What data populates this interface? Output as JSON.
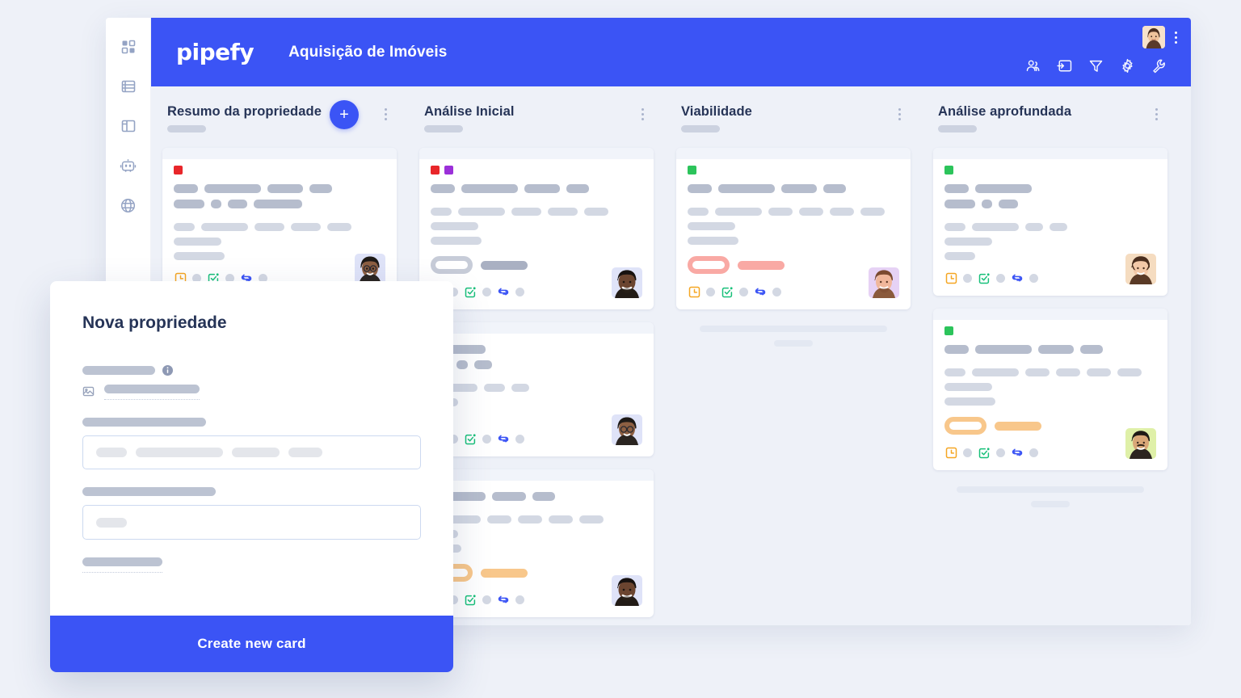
{
  "app": {
    "logo_text": "pipefy",
    "board_title": "Aquisição de Imóveis",
    "accent_color": "#3b54f5",
    "board_bg": "#eef1f8"
  },
  "sidebar": {
    "items": [
      {
        "icon": "grid-dashboard-icon",
        "label": ""
      },
      {
        "icon": "database-icon",
        "label": ""
      },
      {
        "icon": "layout-panel-icon",
        "label": ""
      },
      {
        "icon": "robot-automation-icon",
        "label": ""
      },
      {
        "icon": "globe-icon",
        "label": ""
      }
    ]
  },
  "topbar": {
    "avatar_alt": "user-avatar",
    "kebab": "⋮",
    "icons": [
      {
        "name": "members-icon"
      },
      {
        "name": "import-card-icon"
      },
      {
        "name": "filter-icon"
      },
      {
        "name": "settings-gear-icon"
      },
      {
        "name": "tools-wrench-icon"
      }
    ]
  },
  "board": {
    "add_card_label": "+",
    "columns": [
      {
        "title": "Resumo da propriedade",
        "has_add_button": true,
        "cards": [
          {
            "chips": [
              "#e8262a"
            ],
            "title_widths": [
              [
                30,
                70,
                44,
                28
              ],
              [
                38,
                13,
                24,
                60
              ]
            ],
            "body_widths": [
              [
                26,
                58,
                37,
                37,
                30
              ],
              [
                59
              ],
              [
                63
              ]
            ],
            "badge": null,
            "avatar_bg": "#dfe3f8",
            "avatar_tone": "#6b4a36"
          }
        ],
        "ghost": false
      },
      {
        "title": "Análise Inicial",
        "has_add_button": false,
        "cards": [
          {
            "chips": [
              "#e8262a",
              "#9b30d9"
            ],
            "title_widths": [
              [
                30,
                70,
                44,
                28
              ]
            ],
            "body_widths": [
              [
                26,
                58,
                37,
                37,
                30
              ],
              [
                59
              ],
              [
                63
              ]
            ],
            "badge": "outline-gray",
            "avatar_bg": "#dfe3f8",
            "avatar_tone": "#4e3328"
          },
          {
            "chips": [],
            "title_widths": [
              [
                68
              ],
              [
                24,
                14,
                22
              ]
            ],
            "body_widths": [
              [
                58,
                26,
                22
              ],
              [
                34
              ],
              [
                10
              ]
            ],
            "badge": null,
            "avatar_bg": "#dfe3f8",
            "avatar_tone": "#6b4a36"
          },
          {
            "chips": [],
            "title_widths": [
              [
                68,
                42,
                28
              ]
            ],
            "body_widths": [
              [
                62,
                30,
                30,
                30,
                30
              ],
              [
                34
              ],
              [
                38
              ]
            ],
            "badge": "orange",
            "avatar_bg": "#dfe3f8",
            "avatar_tone": "#4e3328"
          }
        ],
        "ghost": false
      },
      {
        "title": "Viabilidade",
        "has_add_button": false,
        "cards": [
          {
            "chips": [
              "#2cc45b"
            ],
            "title_widths": [
              [
                30,
                70,
                44,
                28
              ]
            ],
            "body_widths": [
              [
                26,
                58,
                30,
                30,
                30,
                30
              ],
              [
                59
              ],
              [
                63
              ]
            ],
            "badge": "red",
            "avatar_bg": "#e6d2f5",
            "avatar_tone": "#e0a98b"
          }
        ],
        "ghost": true
      },
      {
        "title": "Análise aprofundada",
        "has_add_button": false,
        "cards": [
          {
            "chips": [
              "#2cc45b"
            ],
            "title_widths": [
              [
                30,
                70
              ],
              [
                38,
                13,
                24
              ]
            ],
            "body_widths": [
              [
                26,
                58,
                22,
                22
              ],
              [
                59
              ],
              [
                38
              ]
            ],
            "badge": null,
            "avatar_bg": "#f5dcc0",
            "avatar_tone": "#e8c0a0"
          },
          {
            "chips": [
              "#2cc45b"
            ],
            "title_widths": [
              [
                30,
                70,
                44,
                28
              ]
            ],
            "body_widths": [
              [
                26,
                58,
                30,
                30,
                30,
                30
              ],
              [
                59
              ],
              [
                63
              ]
            ],
            "badge": "orange",
            "avatar_bg": "#dff0a8",
            "avatar_tone": "#d9a778"
          }
        ],
        "ghost": true
      }
    ],
    "card_footer_icons": [
      {
        "name": "due-date-clock-icon",
        "color": "#f5a623"
      },
      {
        "name": "checklist-icon",
        "color": "#18c07a"
      },
      {
        "name": "connection-sync-icon",
        "color": "#3b54f5"
      }
    ]
  },
  "modal": {
    "title": "Nova propriedade",
    "submit_label": "Create new card",
    "fields": [
      {
        "name": "attachment-field",
        "label_width": 90,
        "has_info_icon": true,
        "has_image_icon": true,
        "value_width": 118
      },
      {
        "name": "description-field",
        "label_width": 153,
        "input_type": "chips",
        "chip_widths": [
          38,
          108,
          59,
          42
        ]
      },
      {
        "name": "short-text-field",
        "label_width": 165,
        "input_type": "single",
        "chip_widths": [
          38
        ]
      },
      {
        "name": "dotted-field",
        "label_width": 99,
        "input_type": "dotted"
      }
    ]
  }
}
